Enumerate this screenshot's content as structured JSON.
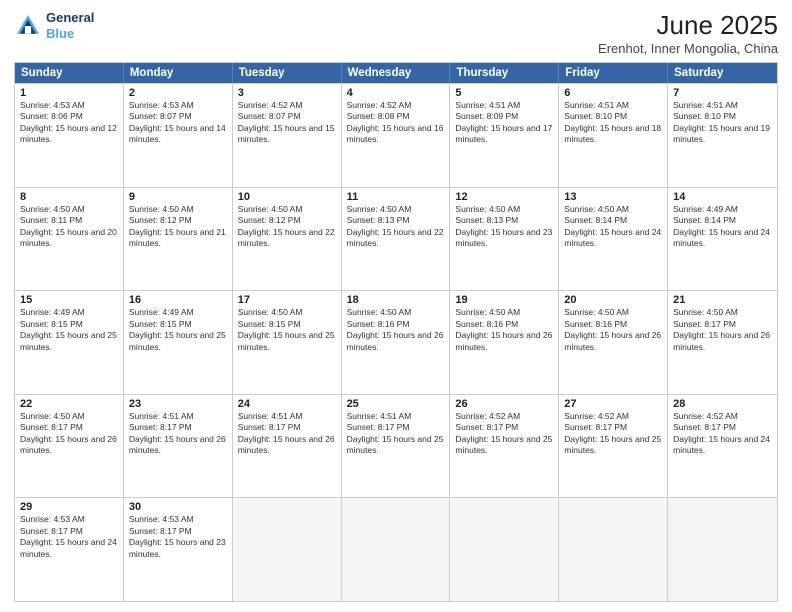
{
  "logo": {
    "line1": "General",
    "line2": "Blue"
  },
  "title": "June 2025",
  "subtitle": "Erenhot, Inner Mongolia, China",
  "headers": [
    "Sunday",
    "Monday",
    "Tuesday",
    "Wednesday",
    "Thursday",
    "Friday",
    "Saturday"
  ],
  "rows": [
    [
      {
        "day": "1",
        "sunrise": "4:53 AM",
        "sunset": "8:06 PM",
        "daylight": "15 hours and 12 minutes."
      },
      {
        "day": "2",
        "sunrise": "4:53 AM",
        "sunset": "8:07 PM",
        "daylight": "15 hours and 14 minutes."
      },
      {
        "day": "3",
        "sunrise": "4:52 AM",
        "sunset": "8:07 PM",
        "daylight": "15 hours and 15 minutes."
      },
      {
        "day": "4",
        "sunrise": "4:52 AM",
        "sunset": "8:08 PM",
        "daylight": "15 hours and 16 minutes."
      },
      {
        "day": "5",
        "sunrise": "4:51 AM",
        "sunset": "8:09 PM",
        "daylight": "15 hours and 17 minutes."
      },
      {
        "day": "6",
        "sunrise": "4:51 AM",
        "sunset": "8:10 PM",
        "daylight": "15 hours and 18 minutes."
      },
      {
        "day": "7",
        "sunrise": "4:51 AM",
        "sunset": "8:10 PM",
        "daylight": "15 hours and 19 minutes."
      }
    ],
    [
      {
        "day": "8",
        "sunrise": "4:50 AM",
        "sunset": "8:11 PM",
        "daylight": "15 hours and 20 minutes."
      },
      {
        "day": "9",
        "sunrise": "4:50 AM",
        "sunset": "8:12 PM",
        "daylight": "15 hours and 21 minutes."
      },
      {
        "day": "10",
        "sunrise": "4:50 AM",
        "sunset": "8:12 PM",
        "daylight": "15 hours and 22 minutes."
      },
      {
        "day": "11",
        "sunrise": "4:50 AM",
        "sunset": "8:13 PM",
        "daylight": "15 hours and 22 minutes."
      },
      {
        "day": "12",
        "sunrise": "4:50 AM",
        "sunset": "8:13 PM",
        "daylight": "15 hours and 23 minutes."
      },
      {
        "day": "13",
        "sunrise": "4:50 AM",
        "sunset": "8:14 PM",
        "daylight": "15 hours and 24 minutes."
      },
      {
        "day": "14",
        "sunrise": "4:49 AM",
        "sunset": "8:14 PM",
        "daylight": "15 hours and 24 minutes."
      }
    ],
    [
      {
        "day": "15",
        "sunrise": "4:49 AM",
        "sunset": "8:15 PM",
        "daylight": "15 hours and 25 minutes."
      },
      {
        "day": "16",
        "sunrise": "4:49 AM",
        "sunset": "8:15 PM",
        "daylight": "15 hours and 25 minutes."
      },
      {
        "day": "17",
        "sunrise": "4:50 AM",
        "sunset": "8:15 PM",
        "daylight": "15 hours and 25 minutes."
      },
      {
        "day": "18",
        "sunrise": "4:50 AM",
        "sunset": "8:16 PM",
        "daylight": "15 hours and 26 minutes."
      },
      {
        "day": "19",
        "sunrise": "4:50 AM",
        "sunset": "8:16 PM",
        "daylight": "15 hours and 26 minutes."
      },
      {
        "day": "20",
        "sunrise": "4:50 AM",
        "sunset": "8:16 PM",
        "daylight": "15 hours and 26 minutes."
      },
      {
        "day": "21",
        "sunrise": "4:50 AM",
        "sunset": "8:17 PM",
        "daylight": "15 hours and 26 minutes."
      }
    ],
    [
      {
        "day": "22",
        "sunrise": "4:50 AM",
        "sunset": "8:17 PM",
        "daylight": "15 hours and 26 minutes."
      },
      {
        "day": "23",
        "sunrise": "4:51 AM",
        "sunset": "8:17 PM",
        "daylight": "15 hours and 26 minutes."
      },
      {
        "day": "24",
        "sunrise": "4:51 AM",
        "sunset": "8:17 PM",
        "daylight": "15 hours and 26 minutes."
      },
      {
        "day": "25",
        "sunrise": "4:51 AM",
        "sunset": "8:17 PM",
        "daylight": "15 hours and 25 minutes."
      },
      {
        "day": "26",
        "sunrise": "4:52 AM",
        "sunset": "8:17 PM",
        "daylight": "15 hours and 25 minutes."
      },
      {
        "day": "27",
        "sunrise": "4:52 AM",
        "sunset": "8:17 PM",
        "daylight": "15 hours and 25 minutes."
      },
      {
        "day": "28",
        "sunrise": "4:52 AM",
        "sunset": "8:17 PM",
        "daylight": "15 hours and 24 minutes."
      }
    ],
    [
      {
        "day": "29",
        "sunrise": "4:53 AM",
        "sunset": "8:17 PM",
        "daylight": "15 hours and 24 minutes."
      },
      {
        "day": "30",
        "sunrise": "4:53 AM",
        "sunset": "8:17 PM",
        "daylight": "15 hours and 23 minutes."
      },
      null,
      null,
      null,
      null,
      null
    ]
  ]
}
